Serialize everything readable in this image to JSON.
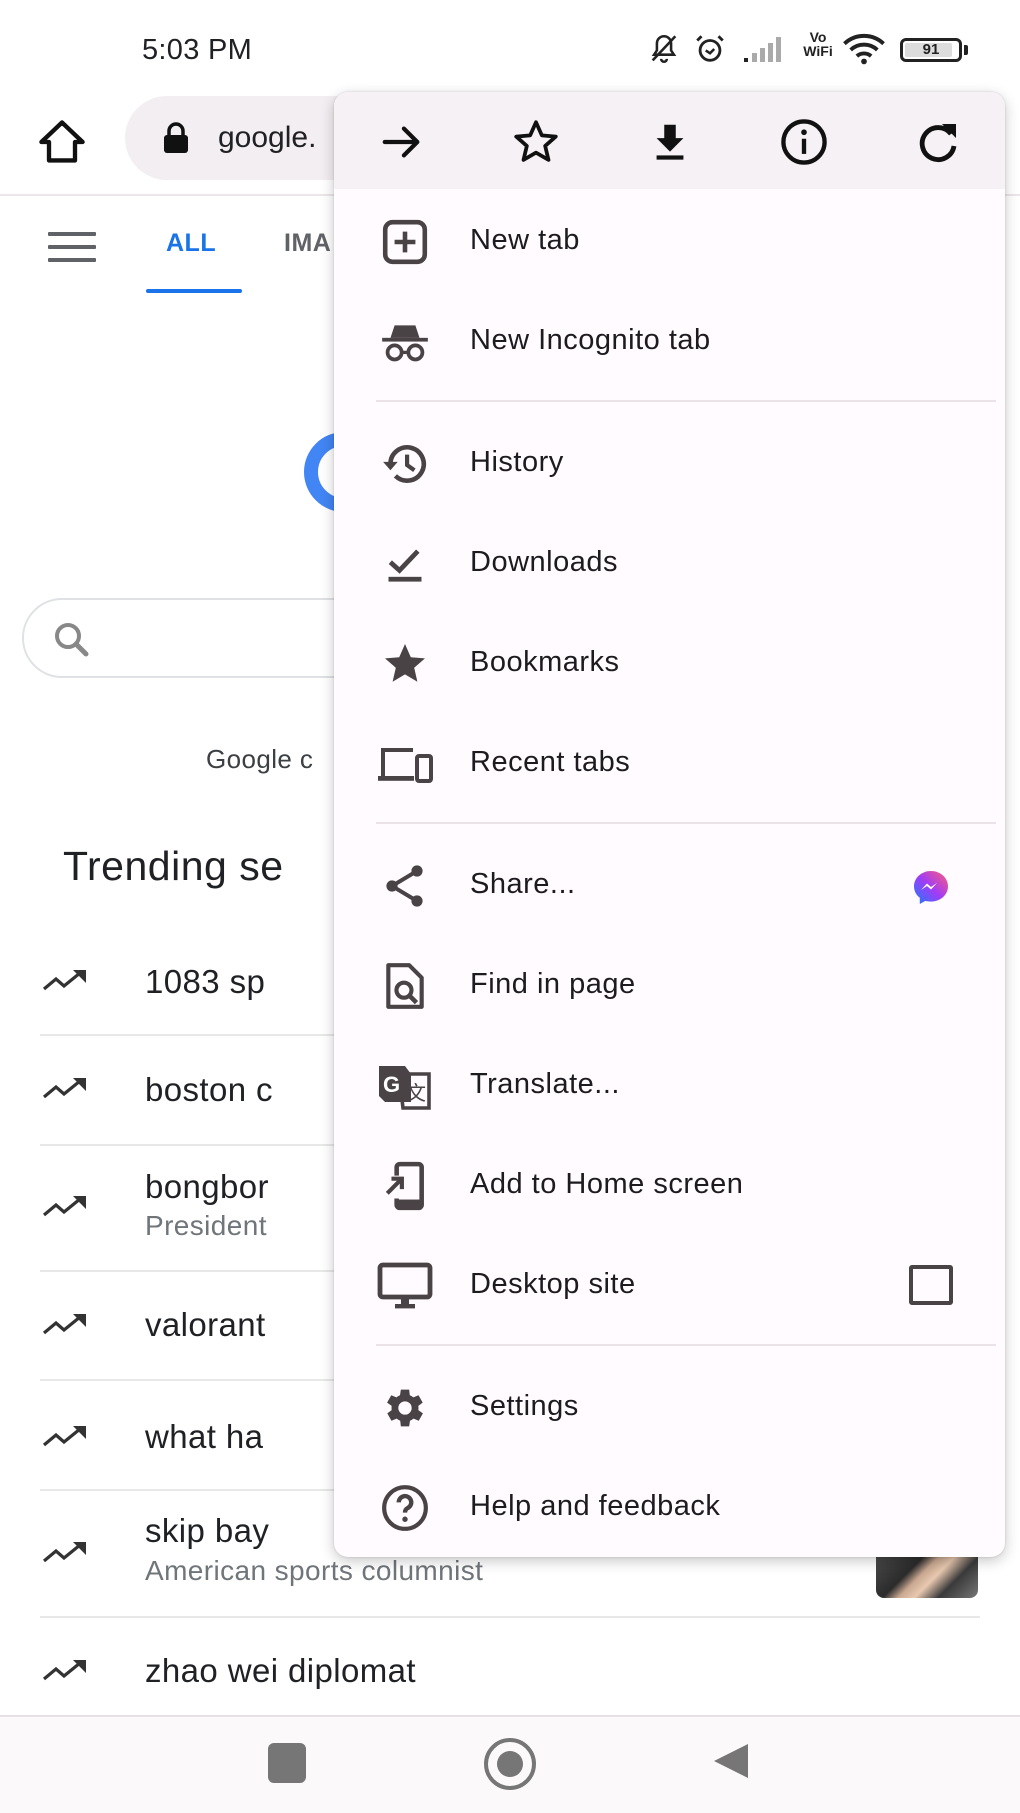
{
  "status_bar": {
    "time": "5:03 PM",
    "icons": [
      "bell-off-icon",
      "alarm-icon",
      "signal-icon",
      "vowifi-icon",
      "wifi-icon",
      "battery-icon"
    ],
    "vowifi_top": "Vo",
    "vowifi_bottom": "WiFi",
    "battery_level": "91",
    "battery_percent": 91
  },
  "toolbar": {
    "url": "google."
  },
  "page": {
    "tabs": [
      {
        "label": "ALL",
        "active": true
      },
      {
        "label": "IMA",
        "active": false
      }
    ],
    "google_offered_text": "Google c",
    "trending_title": "Trending se",
    "trending": [
      {
        "query": "1083 sp",
        "subtitle": ""
      },
      {
        "query": "boston c",
        "subtitle": ""
      },
      {
        "query": "bongbor",
        "subtitle": "President"
      },
      {
        "query": "valorant",
        "subtitle": ""
      },
      {
        "query": "what ha",
        "subtitle": ""
      },
      {
        "query": "skip bay",
        "subtitle": "American sports columnist"
      },
      {
        "query": "zhao wei diplomat",
        "subtitle": ""
      }
    ]
  },
  "menu": {
    "header_actions": [
      {
        "name": "forward",
        "icon": "arrow-right-icon"
      },
      {
        "name": "bookmark",
        "icon": "star-outline-icon"
      },
      {
        "name": "download",
        "icon": "download-icon"
      },
      {
        "name": "page-info",
        "icon": "info-icon"
      },
      {
        "name": "refresh",
        "icon": "refresh-icon"
      }
    ],
    "items": [
      {
        "label": "New tab",
        "icon": "new-tab-icon"
      },
      {
        "label": "New Incognito tab",
        "icon": "incognito-icon"
      },
      {
        "label": "History",
        "icon": "history-icon"
      },
      {
        "label": "Downloads",
        "icon": "downloads-icon"
      },
      {
        "label": "Bookmarks",
        "icon": "bookmarks-star-icon"
      },
      {
        "label": "Recent tabs",
        "icon": "recent-tabs-icon"
      },
      {
        "label": "Share...",
        "icon": "share-icon",
        "trailing": "messenger-icon"
      },
      {
        "label": "Find in page",
        "icon": "find-in-page-icon"
      },
      {
        "label": "Translate...",
        "icon": "translate-icon"
      },
      {
        "label": "Add to Home screen",
        "icon": "add-to-home-icon"
      },
      {
        "label": "Desktop site",
        "icon": "desktop-icon",
        "checked": false
      },
      {
        "label": "Settings",
        "icon": "settings-gear-icon"
      },
      {
        "label": "Help and feedback",
        "icon": "help-icon"
      }
    ]
  },
  "nav_bar": {
    "buttons": [
      "recents",
      "home",
      "back"
    ]
  },
  "colors": {
    "accent": "#1a73e8",
    "menu_bg": "#fffbfe",
    "menu_header_bg": "#f6f1f4",
    "icon": "#4a4346"
  }
}
